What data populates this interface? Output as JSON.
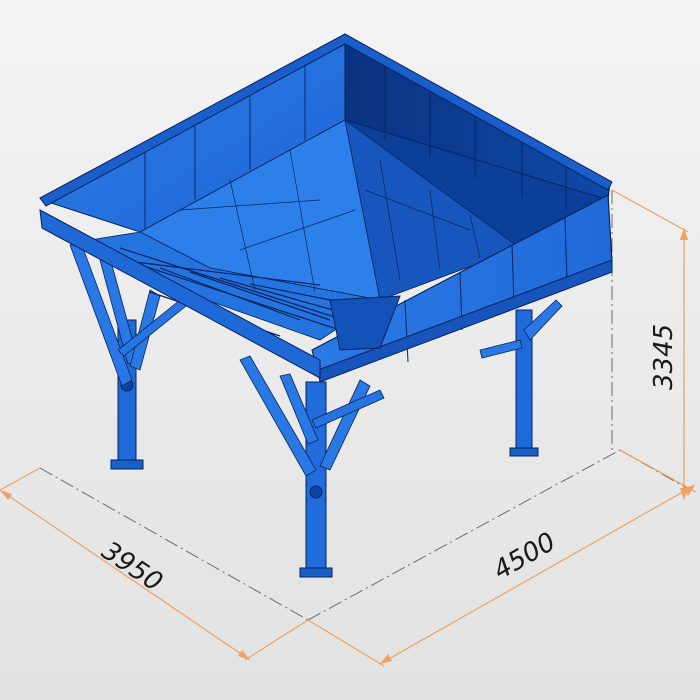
{
  "dimensions": {
    "width": "3950",
    "length": "4500",
    "height": "3345"
  },
  "colors": {
    "steel_light": "#2f82ec",
    "steel_mid": "#1e6ad8",
    "steel_dark": "#0d45a6",
    "steel_shadow": "#0a3380",
    "edge": "#06245e",
    "dimension_line": "#f0a060",
    "centerline": "#6c6c6c"
  }
}
